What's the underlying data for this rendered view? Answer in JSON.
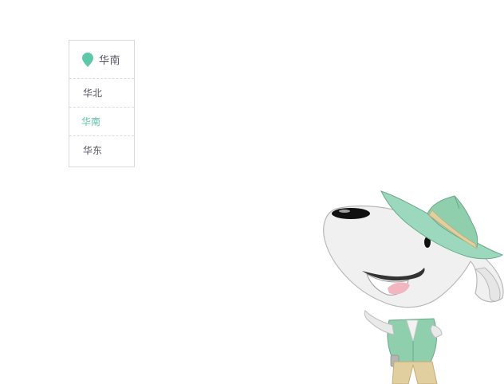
{
  "region_selector": {
    "current": "华南",
    "options": [
      {
        "label": "华北",
        "active": false
      },
      {
        "label": "华南",
        "active": true
      },
      {
        "label": "华东",
        "active": false
      }
    ],
    "accent_color": "#5cc8a8",
    "text_color": "#555566",
    "pin_icon": "location-pin-icon"
  },
  "mascot": {
    "icon": "dog-mascot-illustration"
  }
}
